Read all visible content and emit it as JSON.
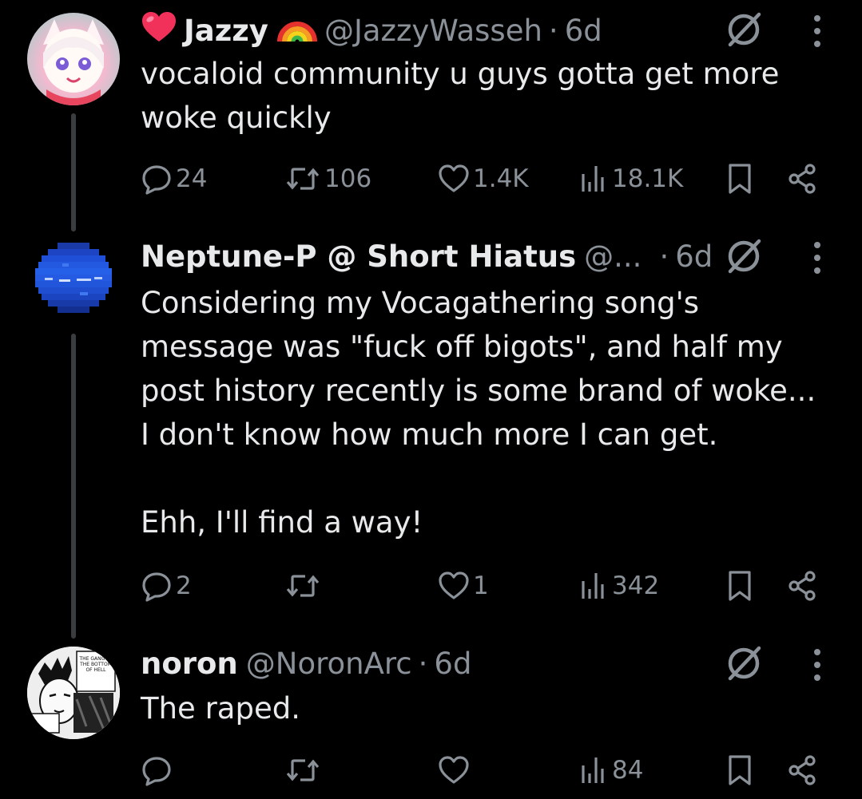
{
  "colors": {
    "background": "#000000",
    "text": "#e7e9ea",
    "muted": "#8b9198",
    "thread_line": "#3a3d40"
  },
  "tweets": [
    {
      "display_name": "Jazzy",
      "prefix_emoji": "heart",
      "suffix_emoji": "rainbow",
      "handle": "@JazzyWasseh",
      "separator": "·",
      "time": "6d",
      "text": "vocaloid community u guys gotta get more\nwoke quickly",
      "replies": "24",
      "reposts": "106",
      "likes": "1.4K",
      "views": "18.1K",
      "icons": [
        "grok-icon",
        "more-icon",
        "reply-icon",
        "repost-icon",
        "like-icon",
        "views-icon",
        "bookmark-icon",
        "share-icon"
      ]
    },
    {
      "display_name": "Neptune-P @ Short Hiatus",
      "handle": "@...",
      "separator": "·",
      "time": "6d",
      "text": "Considering my Vocagathering song's\nmessage was \"fuck off bigots\", and half my\npost history recently is some brand of woke...\nI don't know how much more I can get.\n\nEhh, I'll find a way!",
      "replies": "2",
      "reposts": "",
      "likes": "1",
      "views": "342"
    },
    {
      "display_name": "noron",
      "handle": "@NoronArc",
      "separator": "·",
      "time": "6d",
      "text": "The raped.",
      "replies": "",
      "reposts": "",
      "likes": "",
      "views": "84",
      "avatar_caption": "THE GANG AT THE BOTTOM OF HELL"
    }
  ]
}
